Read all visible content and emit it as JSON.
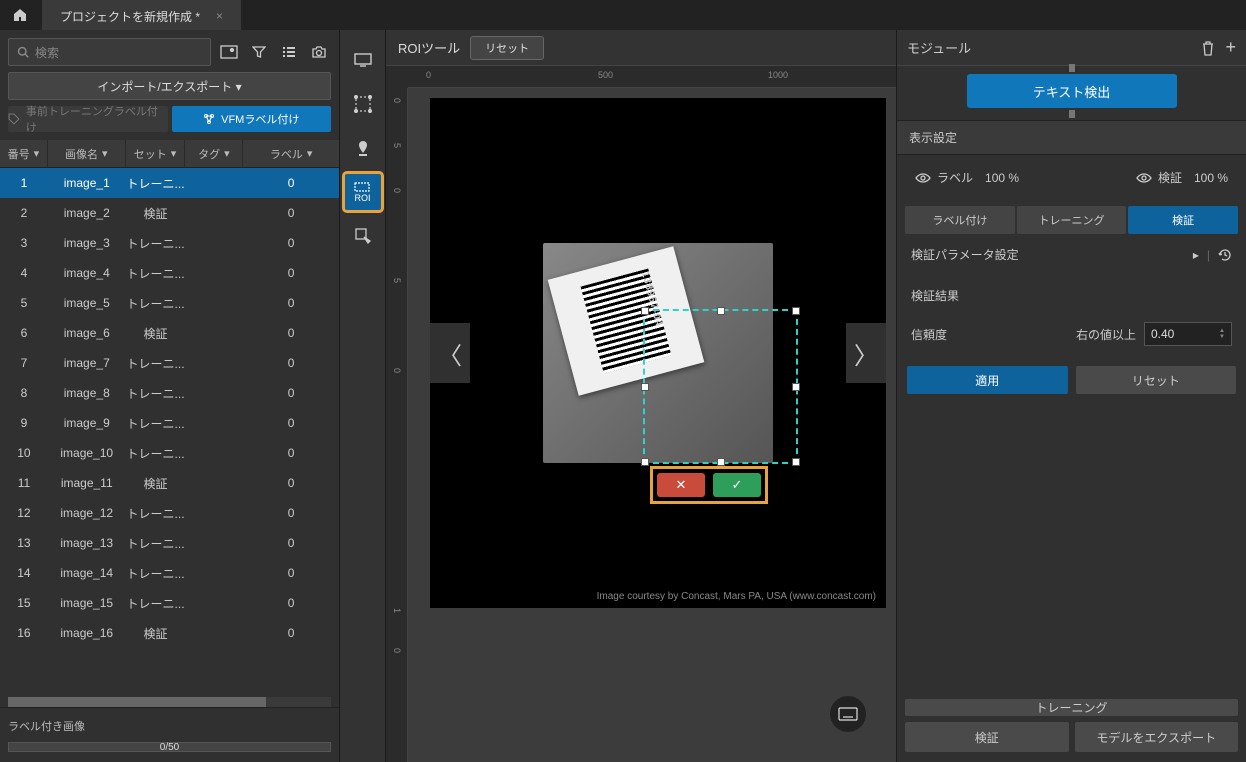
{
  "titlebar": {
    "tab_title": "プロジェクトを新規作成 *"
  },
  "left": {
    "search_placeholder": "検索",
    "import_label": "インポート/エクスポート ▾",
    "chip_pretrain": "事前トレーニングラベル付け",
    "chip_vfm": "VFMラベル付け",
    "headers": {
      "num": "番号",
      "name": "画像名",
      "set": "セット",
      "tag": "タグ",
      "label": "ラベル"
    },
    "rows": [
      {
        "n": "1",
        "name": "image_1",
        "set": "トレーニ...",
        "label": "0",
        "sel": true
      },
      {
        "n": "2",
        "name": "image_2",
        "set": "検証",
        "label": "0"
      },
      {
        "n": "3",
        "name": "image_3",
        "set": "トレーニ...",
        "label": "0"
      },
      {
        "n": "4",
        "name": "image_4",
        "set": "トレーニ...",
        "label": "0"
      },
      {
        "n": "5",
        "name": "image_5",
        "set": "トレーニ...",
        "label": "0"
      },
      {
        "n": "6",
        "name": "image_6",
        "set": "検証",
        "label": "0"
      },
      {
        "n": "7",
        "name": "image_7",
        "set": "トレーニ...",
        "label": "0"
      },
      {
        "n": "8",
        "name": "image_8",
        "set": "トレーニ...",
        "label": "0"
      },
      {
        "n": "9",
        "name": "image_9",
        "set": "トレーニ...",
        "label": "0"
      },
      {
        "n": "10",
        "name": "image_10",
        "set": "トレーニ...",
        "label": "0"
      },
      {
        "n": "11",
        "name": "image_11",
        "set": "検証",
        "label": "0"
      },
      {
        "n": "12",
        "name": "image_12",
        "set": "トレーニ...",
        "label": "0"
      },
      {
        "n": "13",
        "name": "image_13",
        "set": "トレーニ...",
        "label": "0"
      },
      {
        "n": "14",
        "name": "image_14",
        "set": "トレーニ...",
        "label": "0"
      },
      {
        "n": "15",
        "name": "image_15",
        "set": "トレーニ...",
        "label": "0"
      },
      {
        "n": "16",
        "name": "image_16",
        "set": "検証",
        "label": "0"
      }
    ],
    "labeled_title": "ラベル付き画像",
    "progress_text": "0/50"
  },
  "tools": {
    "roi_label": "ROI"
  },
  "center": {
    "header_title": "ROIツール",
    "reset_label": "リセット",
    "ruler_h": [
      "0",
      "500",
      "1000"
    ],
    "ruler_v": [
      "0",
      "5",
      "0",
      "5",
      "0",
      "1",
      "0"
    ],
    "barcode_text": "138957-04",
    "credit": "Image courtesy by Concast, Mars PA, USA (www.concast.com)"
  },
  "right": {
    "header": "モジュール",
    "module_name": "テキスト検出",
    "display_section": "表示設定",
    "vis_label": "ラベル",
    "vis_label_pct": "100 %",
    "vis_verify": "検証",
    "vis_verify_pct": "100 %",
    "tab_label": "ラベル付け",
    "tab_train": "トレーニング",
    "tab_verify": "検証",
    "param_title": "検証パラメータ設定",
    "result_title": "検証結果",
    "conf_label": "信頼度",
    "conf_cond": "右の値以上",
    "conf_value": "0.40",
    "apply": "適用",
    "reset": "リセット",
    "train_btn": "トレーニング",
    "verify_btn": "検証",
    "export_btn": "モデルをエクスポート"
  }
}
